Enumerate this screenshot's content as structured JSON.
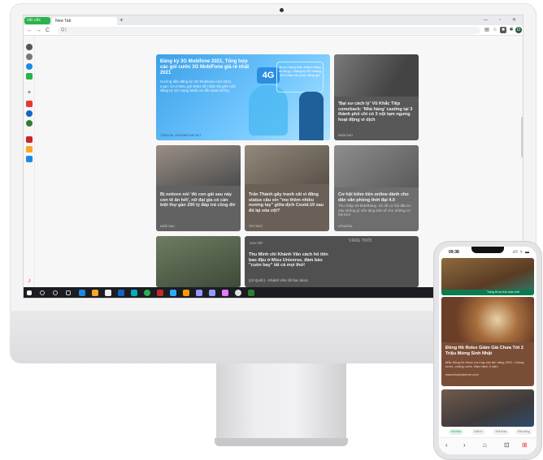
{
  "browser": {
    "brand_label": "cốc cốc",
    "tab_label": "New Tab",
    "tab_add": "+",
    "window_controls": "— ▫ ✕",
    "address_value": "|",
    "nav": {
      "back": "←",
      "forward": "→",
      "reload": "C",
      "search": "Q"
    },
    "account_initial": "G"
  },
  "feed": {
    "ad": {
      "title": "Đăng ký 3G Mobifone 2021, Tổng hợp các gói cước 3G MobiFone giá rẻ nhất 2021",
      "sub": "Hướng dẫn đăng ký 3G Mobifone mới 2021, soạn: DA4 M6U gửi 9084 để nhận khuyến mãi đăng ký 3G mạng Mobi ưu đãi Data không",
      "badge": "4G",
      "callout": "Được hàng triệu khách hàng tin dùng + Đăng ký 3G chiêng tiền Data với phần đăng giá",
      "source": "TONGDAL 3GMOBIFONE.NET"
    },
    "card2": {
      "title": "'Bại sư cách lý' Vũ Khắc Tiệp comeback: 'Nhà hàng' casting tại 3 thành phố chỉ có 3 nội tạm ngưng hoạt động vì dịch",
      "source": "NGÔI SAO"
    },
    "card3": {
      "title": "Bị netizen nói 'đó con gái sau này con tê ăn hết', nữ đại gia có cần biệt thự gần 200 tỷ đáp trả cũng đờ",
      "source": "NGÔI SAO"
    },
    "card4": {
      "title": "Trấn Thành gây tranh cãi vì đăng status câu xin \"mo thêm nhiều nương tay\" giữa dịch Covid-19 sau đó lại xóa vội?",
      "source": "TRI THỨC"
    },
    "card5": {
      "title": "Cơ hội kiếm tiền online dành cho dân văn phòng thời đại 4.0",
      "sub": "Thu nhập 40-50tr/tháng. Sổ dễ cơ hội đầu tư vào những gì nền tảng kinh tế cho những cơ hội lớn!",
      "source": "LPDIGITAL"
    },
    "card7": {
      "label": "XEM TIẾP",
      "brand": "VÀNG TRỜI",
      "title": "Thu Minh chi Khánh Vân cách hồ tiên bao đậu ở Miss Universe, đám bảo \"cuồn bay\" tất cả mọi thứ!",
      "sub": "(10 Quốc) - Khánh Vân rất hạc dược"
    }
  },
  "phone": {
    "time": "09:38",
    "indicators": "ıll ≈ ▬",
    "card1_caption": "Trang tin vụ trọn tuần mới",
    "main_title": "Đồng Hồ Rolex Giảm Giá Chưa Tới 2 Triệu Mừng Sinh Nhật",
    "main_sub": "Mẫu đồng hồ được ưa ứng vận tận năng 2021. Chồng nước, chống xước. Bảo hành 3 năm",
    "main_source": "www.khophukienvn.com",
    "chips": [
      "Hồi tiện",
      "Giải trí",
      "Thể thao",
      "Đời sống"
    ],
    "nav_icons": [
      "‹",
      "›",
      "⌂",
      "⊡",
      "⊞"
    ]
  }
}
